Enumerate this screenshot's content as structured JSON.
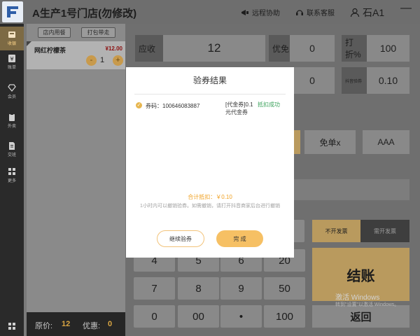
{
  "topbar": {
    "store_title": "A生产1号门店(勿修改)",
    "remote_assist": "远程协助",
    "contact_support": "联系客服",
    "user_name": "石A1",
    "minimize": "—"
  },
  "sidebar": {
    "items": [
      {
        "label": "收银",
        "icon": "cash-register-icon"
      },
      {
        "label": "账单",
        "icon": "yen-bill-icon"
      },
      {
        "label": "会员",
        "icon": "diamond-icon"
      },
      {
        "label": "外卖",
        "icon": "clipboard-icon"
      },
      {
        "label": "交班",
        "icon": "document-icon"
      },
      {
        "label": "更多",
        "icon": "grid-icon"
      }
    ]
  },
  "order": {
    "tab_dine_in": "店内用餐",
    "tab_takeaway": "打包带走",
    "item_name": "网红柠檬茶",
    "item_price": "¥12.00",
    "item_minus": "-",
    "item_qty": "1",
    "item_plus": "+",
    "footer_original_label": "原价:",
    "footer_original_value": "12",
    "footer_discount_label": "优惠:",
    "footer_discount_value": "0"
  },
  "summary": {
    "receivable_label": "应收",
    "receivable_value": "12",
    "free_label": "优免",
    "free_value": "0",
    "discount_pct_label": "打折%",
    "discount_pct_value": "100",
    "row2_value": "0",
    "douyin_label": "抖音验券",
    "douyin_value": "0.10"
  },
  "actions": {
    "free_order": "免单x",
    "aaa": "AAA"
  },
  "invoice": {
    "no_invoice": "不开发票",
    "need_invoice": "需开发票"
  },
  "keypad": {
    "keys": [
      "4",
      "5",
      "6",
      "20",
      "7",
      "8",
      "9",
      "50",
      "0",
      "00",
      "•",
      "100"
    ]
  },
  "checkout": {
    "settle": "结账",
    "back": "返回"
  },
  "watermark": {
    "line1": "激活 Windows",
    "line2": "转到\"设置\"以激活 Windows。"
  },
  "dialog": {
    "title": "验券结果",
    "coupon_code": "券码：100646083887",
    "coupon_type": "[代金券]0.1元代金券",
    "coupon_status": "抵扣成功",
    "total": "合计抵扣：￥0.10",
    "note": "1小时内可以撤销验券。如需撤销，请打开抖音商家后台进行撤销",
    "continue_btn": "继续验券",
    "done_btn": "完 成"
  },
  "colors": {
    "accent": "#f6c064",
    "success": "#3da35d",
    "price_red": "#8c1111"
  }
}
